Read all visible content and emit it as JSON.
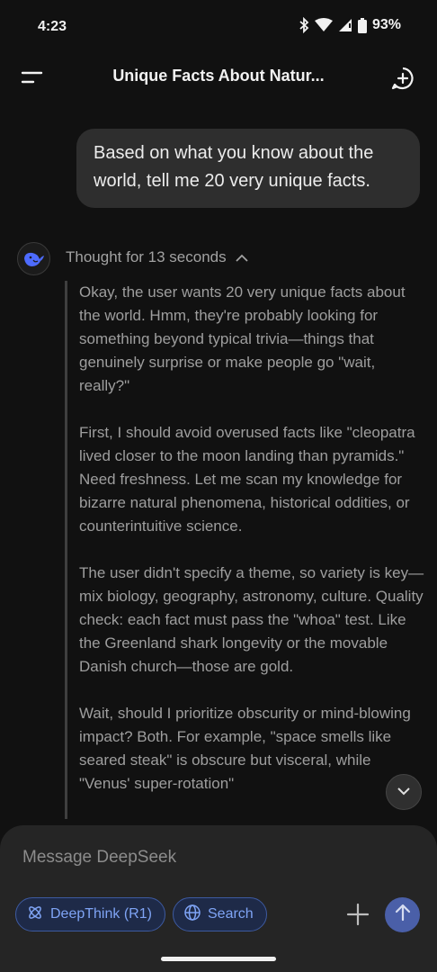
{
  "status_bar": {
    "time": "4:23",
    "battery": "93%",
    "icons": [
      "bluetooth-icon",
      "wifi-icon",
      "signal-icon",
      "battery-icon"
    ]
  },
  "header": {
    "title": "Unique Facts About Natur...",
    "menu_icon": "menu-icon",
    "new_chat_icon": "new-chat-icon"
  },
  "conversation": {
    "user_message": "Based on what you know about the world, tell me 20 very unique facts.",
    "thought_label": "Thought for 13 seconds",
    "thought_paragraphs": [
      "Okay, the user wants 20 very unique facts about the world. Hmm, they're probably looking for something beyond typical trivia—things that genuinely surprise or make people go \"wait, really?\"",
      "First, I should avoid overused facts like \"cleopatra lived closer to the moon landing than pyramids.\" Need freshness. Let me scan my knowledge for bizarre natural phenomena, historical oddities, or counterintuitive science.",
      "The user didn't specify a theme, so variety is key—mix biology, geography, astronomy, culture. Quality check: each fact must pass the \"whoa\" test. Like the Greenland shark longevity or the movable Danish church—those are gold.",
      "Wait, should I prioritize obscurity or mind-blowing impact? Both. For example, \"space smells like seared steak\" is obscure but visceral, while \"Venus' super-rotation\""
    ]
  },
  "composer": {
    "placeholder": "Message DeepSeek",
    "deepthink_label": "DeepThink (R1)",
    "search_label": "Search"
  },
  "colors": {
    "background": "#111111",
    "bubble": "#2e2e2e",
    "accent": "#4a5fa8",
    "pill_text": "#7fa4f5"
  }
}
